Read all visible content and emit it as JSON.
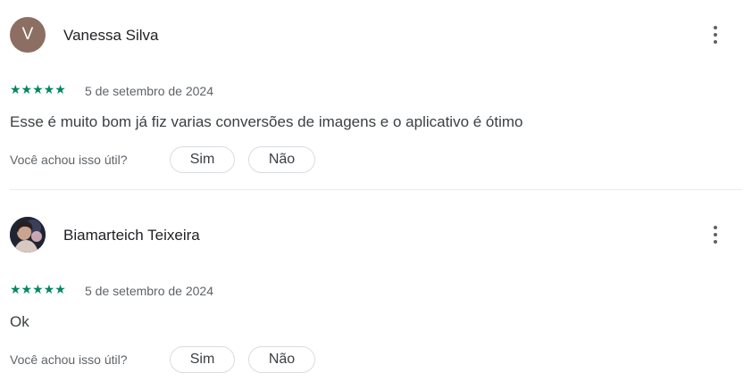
{
  "reviews": [
    {
      "author": "Vanessa Silva",
      "avatar_letter": "V",
      "rating": 5,
      "stars": "★★★★★",
      "date": "5 de setembro de 2024",
      "text": "Esse é muito bom já fiz varias conversões de imagens e o aplicativo é ótimo",
      "helpful_question": "Você achou isso útil?",
      "yes_label": "Sim",
      "no_label": "Não"
    },
    {
      "author": "Biamarteich Teixeira",
      "rating": 5,
      "stars": "★★★★★",
      "date": "5 de setembro de 2024",
      "text": "Ok",
      "helpful_question": "Você achou isso útil?",
      "yes_label": "Sim",
      "no_label": "Não"
    }
  ],
  "colors": {
    "star": "#01875f",
    "avatar_bg": "#8d6e63"
  },
  "icons": [
    "more-vert-icon"
  ]
}
